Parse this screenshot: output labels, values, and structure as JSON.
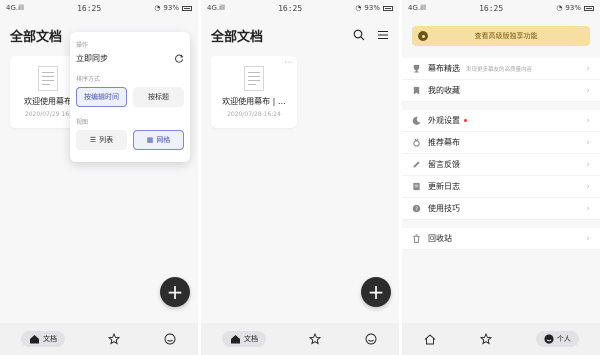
{
  "status": {
    "left": "4G.ill",
    "time": "16:25",
    "battery": "93%"
  },
  "screen1": {
    "title": "全部文档",
    "card": {
      "name": "欢迎使用幕布",
      "date": "2020/07/29 16:"
    },
    "menu": {
      "section_ops": "操作",
      "sync": "立即同步",
      "section_sort": "排序方式",
      "sort_time": "按编辑时间",
      "sort_title": "按标题",
      "section_view": "视图",
      "view_list": "列表",
      "view_grid": "网格"
    }
  },
  "screen2": {
    "title": "全部文档",
    "card": {
      "name": "欢迎使用幕布 | …",
      "date": "2020/07/28 16:24"
    }
  },
  "nav": {
    "docs": "文档",
    "personal": "个人"
  },
  "screen3": {
    "banner": "查看高级版独享功能",
    "items": [
      {
        "label": "幕布精选",
        "sub": "发现更多幕友的高质量内容"
      },
      {
        "label": "我的收藏"
      },
      {
        "label": "外观设置"
      },
      {
        "label": "推荐幕布"
      },
      {
        "label": "留言反馈"
      },
      {
        "label": "更新日志"
      },
      {
        "label": "使用技巧"
      },
      {
        "label": "回收站"
      }
    ]
  },
  "colors": {
    "accent": "#4654b8",
    "banner": "#f6dfa3",
    "fab": "#2d2d2d"
  }
}
